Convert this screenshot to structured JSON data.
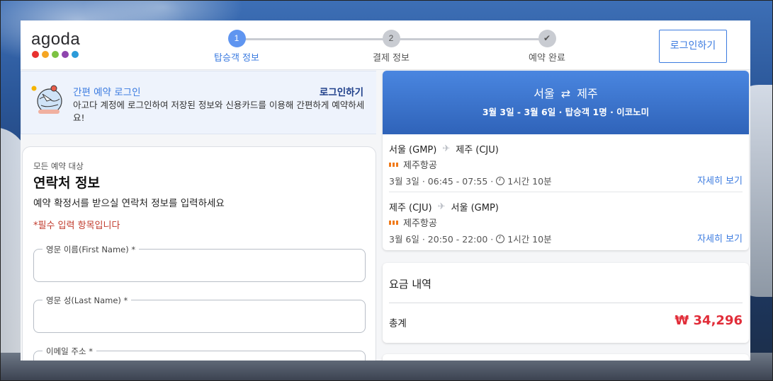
{
  "brand": {
    "logo_text": "agoda",
    "dot_colors": [
      "#e8312f",
      "#f5a623",
      "#7cc242",
      "#8e44ad",
      "#2b9bd9"
    ]
  },
  "stepper": {
    "steps": [
      {
        "number": "1",
        "label": "탑승객 정보",
        "state": "active"
      },
      {
        "number": "2",
        "label": "결제 정보",
        "state": "pending"
      },
      {
        "number": "✔",
        "label": "예약 완료",
        "state": "pending"
      }
    ]
  },
  "header": {
    "login_button": "로그인하기"
  },
  "quick_login": {
    "title": "간편 예약 로그인",
    "link": "로그인하기",
    "description": "아고다 계정에 로그인하여 저장된 정보와 신용카드를 이용해 간편하게 예약하세요!"
  },
  "contact": {
    "eyebrow": "모든 예약 대상",
    "title": "연락처 정보",
    "subtitle": "예약 확정서를 받으실 연락처 정보를 입력하세요",
    "required_note": "*필수 입력 항목입니다",
    "fields": [
      {
        "label": "영문 이름(First Name) *",
        "value": ""
      },
      {
        "label": "영문 성(Last Name) *",
        "value": ""
      },
      {
        "label": "이메일 주소 *",
        "value": ""
      }
    ]
  },
  "flight": {
    "route_from": "서울",
    "route_arrow": "⇄",
    "route_to": "제주",
    "meta": "3월 3일 - 3월 6일 · 탑승객 1명 · 이코노미",
    "segments": [
      {
        "origin": "서울 (GMP)",
        "destination": "제주 (CJU)",
        "airline": "제주항공",
        "time": "3월 3일 · 06:45 - 07:55 ·",
        "duration": "1시간 10분",
        "detail_link": "자세히 보기"
      },
      {
        "origin": "제주 (CJU)",
        "destination": "서울 (GMP)",
        "airline": "제주항공",
        "time": "3월 6일 · 20:50 - 22:00 ·",
        "duration": "1시간 10분",
        "detail_link": "자세히 보기"
      }
    ]
  },
  "price": {
    "title": "요금 내역",
    "total_label": "총계",
    "total_value": "₩ 34,296"
  },
  "colors": {
    "accent": "#3b7be0",
    "header_gradient_top": "#4a86e0",
    "price_red": "#e12d39",
    "required_red": "#c0392b"
  }
}
